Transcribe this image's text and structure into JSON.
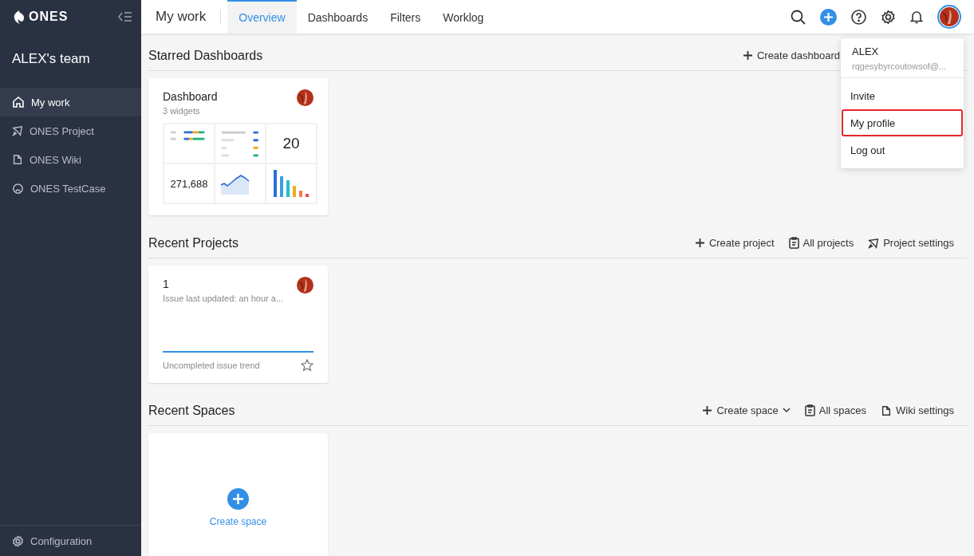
{
  "logo": {
    "text": "ONES"
  },
  "sidebar": {
    "team": "ALEX's team",
    "items": [
      {
        "label": "My work",
        "kind": "home",
        "selected": true
      },
      {
        "label": "ONES Project",
        "kind": "project",
        "selected": false
      },
      {
        "label": "ONES Wiki",
        "kind": "wiki",
        "selected": false
      },
      {
        "label": "ONES TestCase",
        "kind": "testcase",
        "selected": false
      }
    ],
    "footer": {
      "label": "Configuration"
    }
  },
  "topbar": {
    "title": "My work",
    "tabs": [
      {
        "label": "Overview",
        "selected": true
      },
      {
        "label": "Dashboards",
        "selected": false
      },
      {
        "label": "Filters",
        "selected": false
      },
      {
        "label": "Worklog",
        "selected": false
      }
    ]
  },
  "sections": [
    {
      "kind": "dashboards",
      "title": "Starred Dashboards",
      "actions": [
        {
          "label": "Create dashboard",
          "kind": "create",
          "dropdown": false
        }
      ],
      "cards": [
        {
          "title": "Dashboard",
          "subtitle": "3 widgets",
          "metric": "20",
          "total": "271,688"
        }
      ]
    },
    {
      "kind": "projects",
      "title": "Recent Projects",
      "actions": [
        {
          "label": "Create project",
          "kind": "create",
          "dropdown": false
        },
        {
          "label": "All projects",
          "kind": "list",
          "dropdown": false
        },
        {
          "label": "Project settings",
          "kind": "project",
          "dropdown": false
        }
      ],
      "cards": [
        {
          "title": "1",
          "subtitle": "Issue last updated: an hour a...",
          "footer": "Uncompleted issue trend",
          "starred": false
        }
      ]
    },
    {
      "kind": "spaces",
      "title": "Recent Spaces",
      "actions": [
        {
          "label": "Create space",
          "kind": "create",
          "dropdown": true
        },
        {
          "label": "All spaces",
          "kind": "list",
          "dropdown": false
        },
        {
          "label": "Wiki settings",
          "kind": "wiki",
          "dropdown": false
        }
      ],
      "cards": [
        {
          "label": "Create space"
        }
      ]
    }
  ],
  "user_menu": {
    "name": "ALEX",
    "email": "rqgesybyrcoutowsof@...",
    "items": [
      {
        "label": "Invite",
        "highlighted": false
      },
      {
        "label": "My profile",
        "highlighted": true
      },
      {
        "label": "Log out",
        "highlighted": false
      }
    ]
  }
}
